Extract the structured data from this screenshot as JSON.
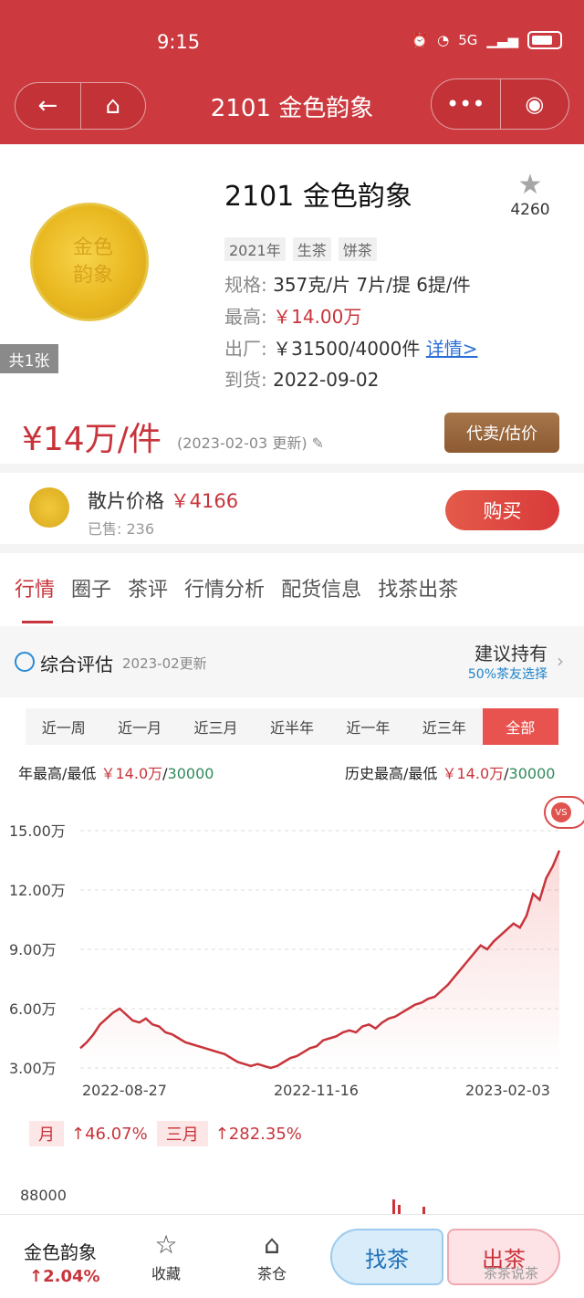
{
  "status": {
    "time": "9:15",
    "signal": "5G"
  },
  "nav": {
    "title": "2101 金色韵象",
    "back_icon": "back-arrow-icon",
    "home_icon": "home-icon",
    "more_icon": "more-dots-icon",
    "target_icon": "target-icon"
  },
  "product": {
    "title": "2101 金色韵象",
    "fav_count": "4260",
    "image_count": "共1张",
    "tags": [
      "2021年",
      "生茶",
      "饼茶"
    ],
    "spec_k": "规格:",
    "spec_v": "357克/片 7片/提 6提/件",
    "high_k": "最高:",
    "high_v": "￥14.00万",
    "factory_k": "出厂:",
    "factory_v": "￥31500/4000件",
    "factory_link": "详情>",
    "arrive_k": "到货:",
    "arrive_v": "2022-09-02"
  },
  "price": {
    "main": "¥14万/件",
    "date": "(2023-02-03 更新)",
    "sell_button": "代卖/估价"
  },
  "loose": {
    "label": "散片价格",
    "price": "￥4166",
    "sold": "已售: 236",
    "buy_button": "购买"
  },
  "tabs": [
    "行情",
    "圈子",
    "茶评",
    "行情分析",
    "配货信息",
    "找茶出茶"
  ],
  "eval": {
    "title": "综合评估",
    "date": "2023-02更新",
    "suggest": "建议持有",
    "suggest_sub": "50%茶友选择"
  },
  "ranges": [
    "近一周",
    "近一月",
    "近三月",
    "近半年",
    "近一年",
    "近三年",
    "全部"
  ],
  "highlow": {
    "year_label": "年最高/最低",
    "year_high": "￥14.0万",
    "year_sep": "/",
    "year_low": "30000",
    "hist_label": "历史最高/最低",
    "hist_high": "￥14.0万",
    "hist_sep": "/",
    "hist_low": "30000"
  },
  "vs_label": "VS",
  "chart_data": {
    "type": "area",
    "y_ticks": [
      "15.00万",
      "12.00万",
      "9.00万",
      "6.00万",
      "3.00万"
    ],
    "x_ticks": [
      "2022-08-27",
      "2022-11-16",
      "2023-02-03"
    ],
    "ylim": [
      30000,
      150000
    ],
    "series": [
      {
        "values": [
          40000,
          43000,
          47000,
          52000,
          55000,
          58000,
          60000,
          57000,
          54000,
          53000,
          55000,
          52000,
          51000,
          48000,
          47000,
          45000,
          43000,
          42000,
          41000,
          40000,
          39000,
          38000,
          37000,
          35000,
          33000,
          32000,
          31000,
          32000,
          31000,
          30000,
          31000,
          33000,
          35000,
          36000,
          38000,
          40000,
          41000,
          44000,
          45000,
          46000,
          48000,
          49000,
          48000,
          51000,
          52000,
          50000,
          53000,
          55000,
          56000,
          58000,
          60000,
          62000,
          63000,
          65000,
          66000,
          69000,
          72000,
          76000,
          80000,
          84000,
          88000,
          92000,
          90000,
          94000,
          97000,
          100000,
          103000,
          101000,
          107000,
          118000,
          115000,
          126000,
          132000,
          140000
        ]
      }
    ]
  },
  "changes": {
    "month_label": "月",
    "month_val": "↑46.07%",
    "quarter_label": "三月",
    "quarter_val": "↑282.35%"
  },
  "volume_tick": "88000",
  "bottom": {
    "name": "金色韵象",
    "pct": "↑2.04%",
    "fav": "收藏",
    "store": "茶仓",
    "find": "找茶",
    "out": "出茶",
    "watermark": "茶茶说茶"
  }
}
